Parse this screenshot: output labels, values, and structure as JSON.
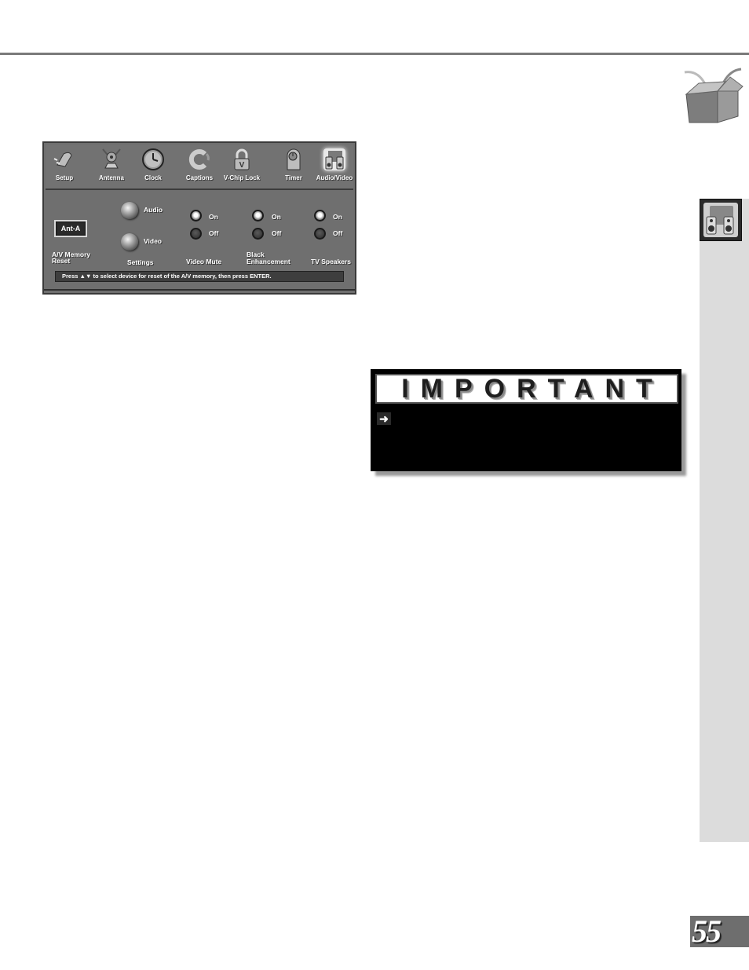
{
  "page": {
    "page_number": "55"
  },
  "tv_menu": {
    "icons": [
      {
        "label": "Setup",
        "icon": "plug-icon"
      },
      {
        "label": "Antenna",
        "icon": "antenna-icon"
      },
      {
        "label": "Clock",
        "icon": "clock-icon"
      },
      {
        "label": "Captions",
        "icon": "captions-icon"
      },
      {
        "label": "V-Chip Lock",
        "icon": "lock-icon"
      },
      {
        "label": "Timer",
        "icon": "timer-icon"
      },
      {
        "label": "Audio/Video",
        "icon": "speakers-icon",
        "active": true
      }
    ],
    "memory_reset": {
      "value": "Ant-A",
      "label_line1": "A/V Memory",
      "label_line2": "Reset"
    },
    "settings": {
      "audio_label": "Audio",
      "video_label": "Video",
      "label": "Settings"
    },
    "video_mute": {
      "label": "Video Mute",
      "on_label": "On",
      "off_label": "Off",
      "selected": "On"
    },
    "black_enhancement": {
      "label_line1": "Black",
      "label_line2": "Enhancement",
      "on_label": "On",
      "off_label": "Off",
      "selected": "On"
    },
    "tv_speakers": {
      "label": "TV Speakers",
      "on_label": "On",
      "off_label": "Off",
      "selected": "On"
    },
    "status": "Press ▲▼ to select device for reset of the A/V memory, then press ENTER."
  },
  "important": {
    "title": "IMPORTANT",
    "arrow_icon": "right-arrow-icon"
  },
  "icons": {
    "box": "open-box-icon",
    "side_tab": "speakers-icon"
  }
}
